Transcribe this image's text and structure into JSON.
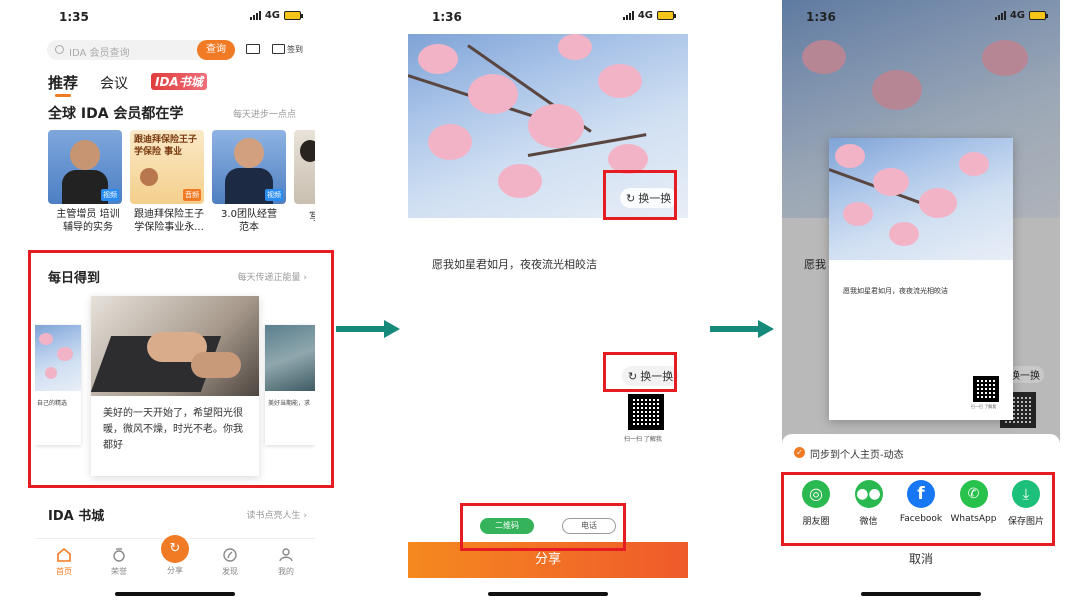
{
  "screen1": {
    "status": {
      "time": "1:35",
      "network": "4G"
    },
    "search": {
      "placeholder": "IDA 会员查询",
      "button": "查询",
      "signin": "签到"
    },
    "tabs": [
      "推荐",
      "会议",
      "IDA书城"
    ],
    "section1": {
      "title": "全球 IDA 会员都在学",
      "more": "每天进步一点点"
    },
    "courses": [
      {
        "title": "主管增员 培训辅导的实务",
        "badge": "视频",
        "title_lines": [
          "主管增员 培训",
          "辅导的实务"
        ]
      },
      {
        "title": "跟迪拜保险王子学保险事业永...",
        "badge": "音频",
        "overlay": "跟迪拜保险王子 学保险 事业",
        "title_lines": [
          "跟迪拜保险王子",
          "学保险事业永..."
        ]
      },
      {
        "title": "3.0团队经营范本",
        "badge": "视频",
        "title_lines": [
          "3.0团队经营",
          "范本"
        ]
      },
      {
        "title": "写",
        "title_lines": [
          "写"
        ]
      }
    ],
    "daily": {
      "title": "每日得到",
      "more": "每天传递正能量",
      "card_text": "美好的一天开始了，希望阳光很暖，微风不燥，时光不老。你我都好",
      "left_card": "自己的精选",
      "right_card": "美好当期能，求"
    },
    "section3": {
      "title": "IDA 书城",
      "more": "读书点亮人生"
    },
    "nav": [
      "首页",
      "荣誉",
      "分享",
      "发现",
      "我的"
    ]
  },
  "screen2": {
    "status": {
      "time": "1:36",
      "network": "4G"
    },
    "swap_top": "换一换",
    "quote": "愿我如星君如月，夜夜流光相皎洁",
    "swap_mid": "换一换",
    "qr_caption": "扫一扫 了解我",
    "options": [
      "二维码",
      "电话"
    ],
    "share": "分享"
  },
  "screen3": {
    "status": {
      "time": "1:36",
      "network": "4G"
    },
    "bg_text": "愿我",
    "swap": "换一换",
    "card_quote": "愿我如星君如月，夜夜流光相皎洁",
    "card_qr_caption": "扫一扫 了解我",
    "sync": "同步到个人主页-动态",
    "share_targets": [
      {
        "label": "朋友圈",
        "color": "#2ab950",
        "icon": "moments-icon"
      },
      {
        "label": "微信",
        "color": "#2ab950",
        "icon": "wechat-icon"
      },
      {
        "label": "Facebook",
        "color": "#1877f2",
        "icon": "facebook-icon"
      },
      {
        "label": "WhatsApp",
        "color": "#27c14b",
        "icon": "whatsapp-icon"
      },
      {
        "label": "保存图片",
        "color": "#1cc07a",
        "icon": "download-icon"
      }
    ],
    "cancel": "取消"
  },
  "colors": {
    "accent": "#f17a24",
    "highlight": "#e51d22",
    "arrow": "#15897a",
    "green": "#34b35a"
  }
}
